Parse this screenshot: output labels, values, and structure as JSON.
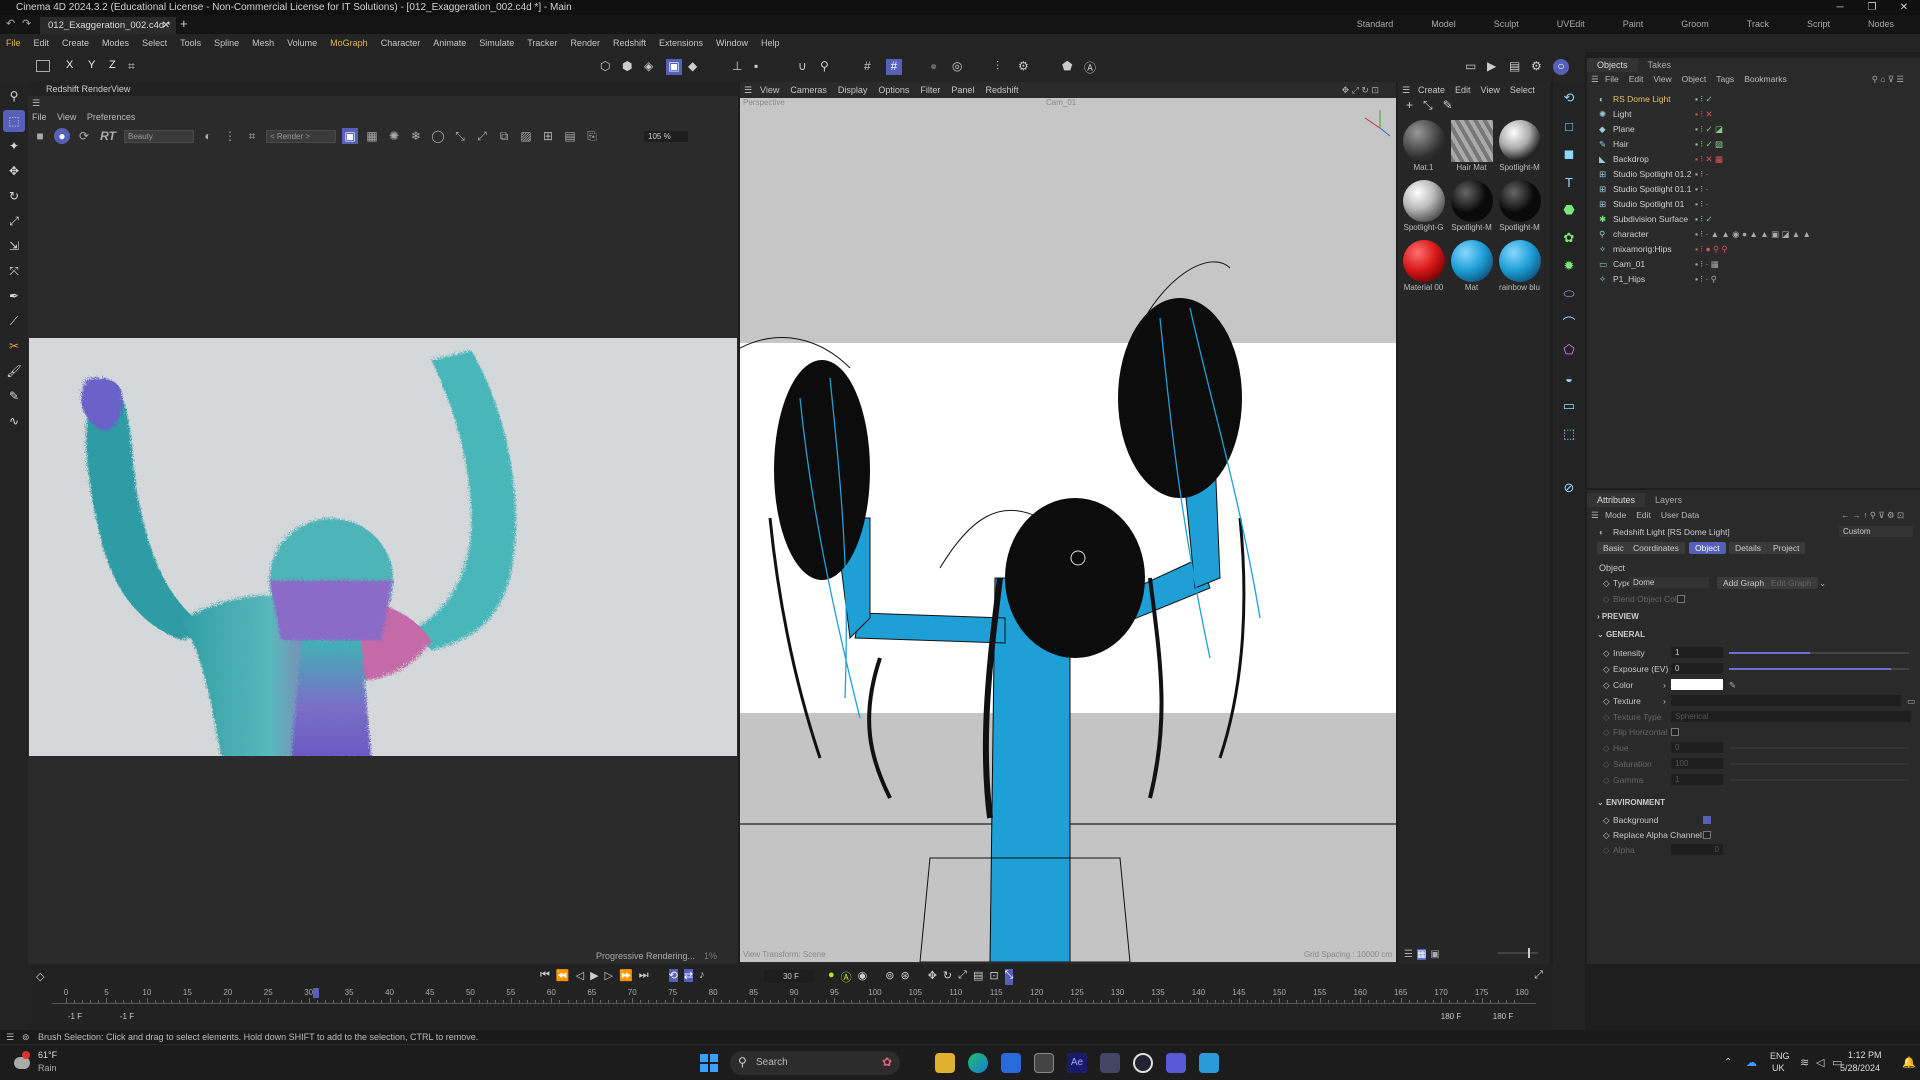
{
  "window": {
    "title": "Cinema 4D 2024.3.2 (Educational License - Non-Commercial License for IT Solutions) - [012_Exaggeration_002.c4d *] - Main",
    "doc_tab": "012_Exaggeration_002.c4d *",
    "layouts": [
      "Standard",
      "Model",
      "Sculpt",
      "UVEdit",
      "Paint",
      "Groom",
      "Track",
      "Script",
      "Nodes"
    ]
  },
  "menubar": [
    "File",
    "Edit",
    "Create",
    "Modes",
    "Select",
    "Tools",
    "Spline",
    "Mesh",
    "Volume",
    "MoGraph",
    "Character",
    "Animate",
    "Simulate",
    "Tracker",
    "Render",
    "Redshift",
    "Extensions",
    "Window",
    "Help"
  ],
  "toolbar": {
    "axis_x": "X",
    "axis_y": "Y",
    "axis_z": "Z"
  },
  "renderview": {
    "title": "Redshift RenderView",
    "menu": [
      "File",
      "View",
      "Preferences"
    ],
    "rt_label": "RT",
    "aov": "Beauty",
    "render_mode": "< Render >",
    "zoom": "105 %",
    "status": "Progressive Rendering...",
    "progress": "1%"
  },
  "viewport": {
    "menu": [
      "View",
      "Cameras",
      "Display",
      "Options",
      "Filter",
      "Panel",
      "Redshift"
    ],
    "label_perspective": "Perspective",
    "label_camera": "Cam_01",
    "label_transform": "View Transform: Scene",
    "grid_spacing": "Grid Spacing : 10000 cm"
  },
  "materials": {
    "menu": [
      "Create",
      "Edit",
      "View",
      "Select"
    ],
    "items": [
      {
        "name": "Mat.1",
        "color": "#505050"
      },
      {
        "name": "Hair Mat",
        "color": "#8a8a8a"
      },
      {
        "name": "Spotlight-M",
        "color": "#d0d0d0"
      },
      {
        "name": "Spotlight-G",
        "color": "#a8a8a8"
      },
      {
        "name": "Spotlight-M",
        "color": "#0a0a0a"
      },
      {
        "name": "Spotlight-M",
        "color": "#0a0a0a"
      },
      {
        "name": "Material 00",
        "color": "#d81818"
      },
      {
        "name": "Mat",
        "color": "#1e9fd6"
      },
      {
        "name": "rainbow blu",
        "color": "#1e9fd6"
      }
    ]
  },
  "objects": {
    "tabs": [
      "Objects",
      "Takes"
    ],
    "menu": [
      "File",
      "Edit",
      "View",
      "Object",
      "Tags",
      "Bookmarks"
    ],
    "rows": [
      {
        "name": "RS Dome Light",
        "color": "#e8c060"
      },
      {
        "name": "Light"
      },
      {
        "name": "Plane"
      },
      {
        "name": "Hair"
      },
      {
        "name": "Backdrop"
      },
      {
        "name": "Studio Spotlight 01.2"
      },
      {
        "name": "Studio Spotlight 01.1"
      },
      {
        "name": "Studio Spotlight 01"
      },
      {
        "name": "Subdivision Surface"
      },
      {
        "name": "character"
      },
      {
        "name": "mixamorig:Hips"
      },
      {
        "name": "Cam_01"
      },
      {
        "name": "P1_Hips"
      }
    ]
  },
  "attributes": {
    "tabs": [
      "Attributes",
      "Layers"
    ],
    "menu": [
      "Mode",
      "Edit",
      "User Data"
    ],
    "object_title": "Redshift Light [RS Dome Light]",
    "preset": "Custom",
    "subtabs": [
      "Basic",
      "Coordinates",
      "Object",
      "Details",
      "Project"
    ],
    "active_subtab": "Object",
    "section_object": "Object",
    "type_label": "Type",
    "type_value": "Dome",
    "add_graph": "Add Graph",
    "edit_graph": "Edit Graph",
    "blend_object_color": "Blend Object Color",
    "section_preview": "PREVIEW",
    "section_general": "GENERAL",
    "intensity_label": "Intensity",
    "intensity_value": "1",
    "intensity_level": 0.45,
    "exposure_label": "Exposure (EV)",
    "exposure_value": "0",
    "exposure_level": 0.9,
    "color_label": "Color",
    "texture_label": "Texture",
    "texture_type_label": "Texture Type",
    "texture_type_value": "Spherical",
    "flip_label": "Flip Horizontal",
    "hue_label": "Hue",
    "hue_value": "0",
    "saturation_label": "Saturation",
    "saturation_value": "100",
    "gamma_label": "Gamma",
    "gamma_value": "1",
    "section_environment": "ENVIRONMENT",
    "background_label": "Background",
    "replace_alpha_label": "Replace Alpha Channel",
    "alpha_label": "Alpha",
    "alpha_value": "0"
  },
  "timeline": {
    "current_frame": "30 F",
    "ticks": [
      "0",
      "5",
      "10",
      "15",
      "20",
      "25",
      "30",
      "35",
      "40",
      "45",
      "50",
      "55",
      "60",
      "65",
      "70",
      "75",
      "80",
      "85",
      "90",
      "95",
      "100",
      "105",
      "110",
      "115",
      "120",
      "125",
      "130",
      "135",
      "140",
      "145",
      "150",
      "155",
      "160",
      "165",
      "170",
      "175",
      "180"
    ],
    "start_a": "-1 F",
    "start_b": "-1 F",
    "end_a": "180 F",
    "end_b": "180 F",
    "playhead_fraction": 0.172
  },
  "status_message": "Brush Selection: Click and drag to select elements. Hold down SHIFT to add to the selection, CTRL to remove.",
  "taskbar": {
    "weather_temp": "61°F",
    "weather_text": "Rain",
    "search_placeholder": "Search",
    "lang_top": "ENG",
    "lang_bottom": "UK",
    "time": "1:12 PM",
    "date": "5/28/2024"
  }
}
